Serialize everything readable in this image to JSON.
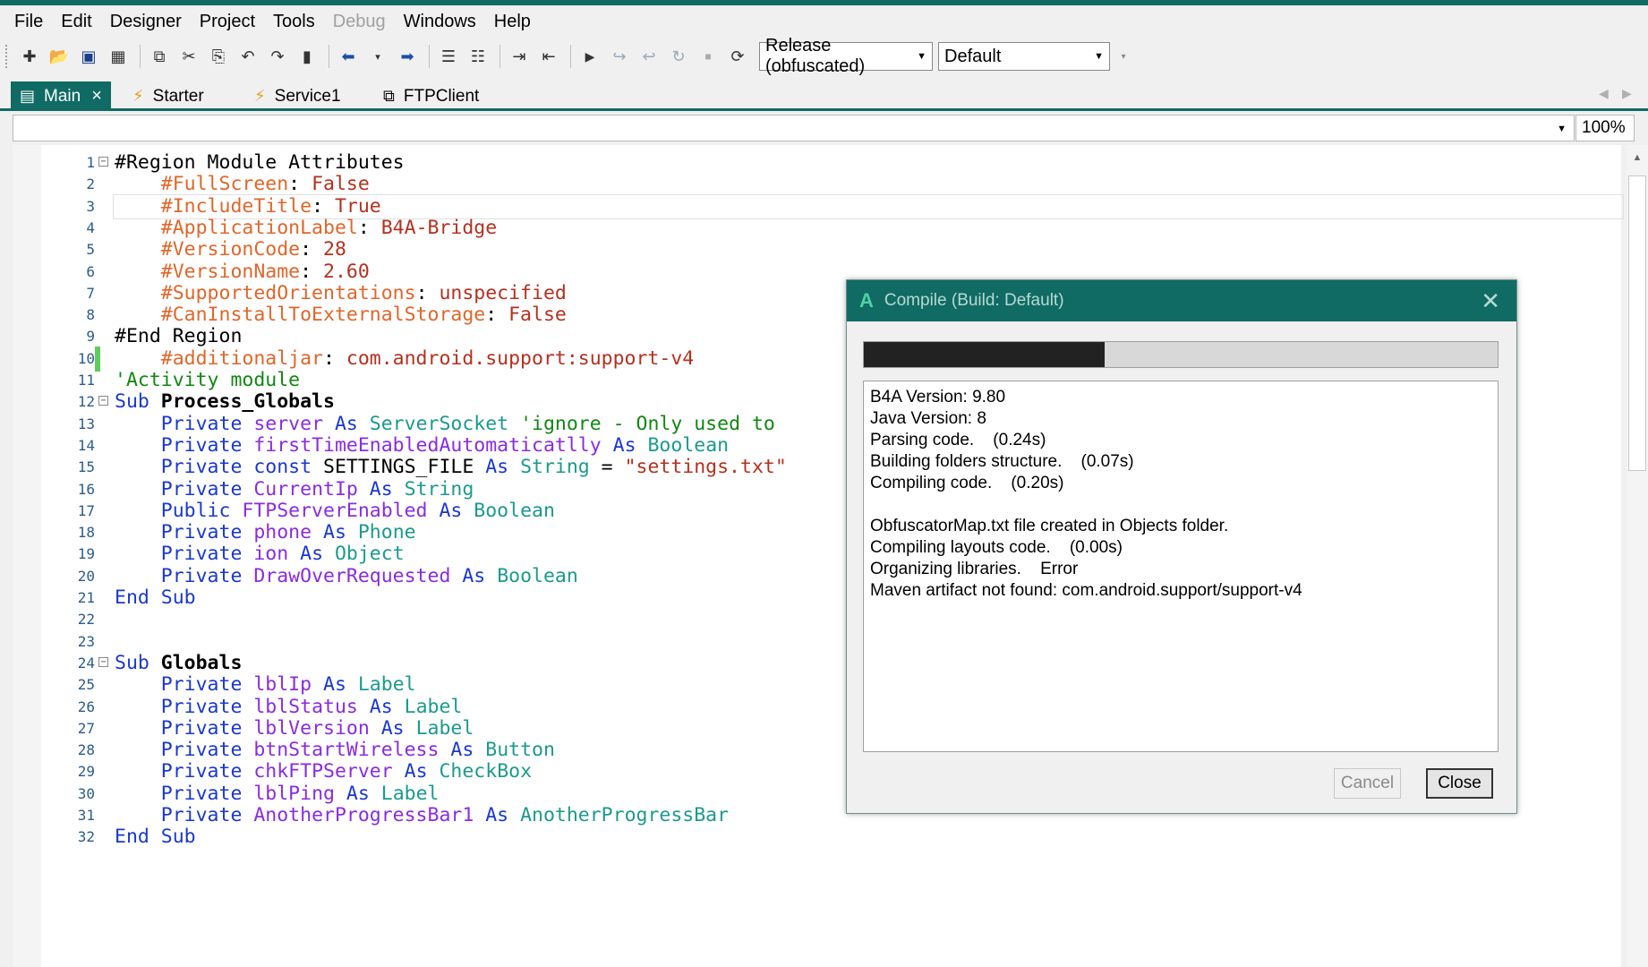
{
  "colors": {
    "accent": "#0f6b63",
    "keyword": "#1a38d0",
    "directive": "#e0662a",
    "type": "#1b9a8e",
    "variable": "#8a2be2",
    "string": "#b5301f",
    "comment": "#118711"
  },
  "menu": [
    "File",
    "Edit",
    "Designer",
    "Project",
    "Tools",
    "Debug",
    "Windows",
    "Help"
  ],
  "toolbar": {
    "build_config": "Release (obfuscated)",
    "build_target": "Default",
    "icons": [
      "new-module-icon",
      "open-icon",
      "save-icon",
      "save-all-icon",
      "copy-icon",
      "cut-icon",
      "paste-icon",
      "undo-icon",
      "redo-icon",
      "bookmark-icon",
      "back-icon",
      "forward-icon",
      "indent-icon",
      "outdent-icon",
      "comment-icon",
      "uncomment-icon",
      "run-icon",
      "step-icon",
      "step-into-icon",
      "step-over-icon",
      "stop-icon",
      "restart-icon"
    ]
  },
  "tabs": [
    {
      "label": "Main",
      "icon": "module-icon",
      "active": true
    },
    {
      "label": "Starter",
      "icon": "service-icon"
    },
    {
      "label": "Service1",
      "icon": "service-icon"
    },
    {
      "label": "FTPClient",
      "icon": "class-icon"
    }
  ],
  "zoom": "100%",
  "code": [
    {
      "n": "1",
      "fold": "⊟",
      "segs": [
        [
          "k-plain",
          "#Region Module Attributes"
        ]
      ]
    },
    {
      "n": "2",
      "segs": [
        [
          "k-plain",
          "    "
        ],
        [
          "k-dir",
          "#FullScreen"
        ],
        [
          "k-plain",
          ": "
        ],
        [
          "k-val",
          "False"
        ]
      ]
    },
    {
      "n": "3",
      "cur": true,
      "segs": [
        [
          "k-plain",
          "    "
        ],
        [
          "k-dir",
          "#IncludeTitle"
        ],
        [
          "k-plain",
          ": "
        ],
        [
          "k-val",
          "True"
        ]
      ]
    },
    {
      "n": "4",
      "segs": [
        [
          "k-plain",
          "    "
        ],
        [
          "k-dir",
          "#ApplicationLabel"
        ],
        [
          "k-plain",
          ": "
        ],
        [
          "k-val",
          "B4A-Bridge"
        ]
      ]
    },
    {
      "n": "5",
      "segs": [
        [
          "k-plain",
          "    "
        ],
        [
          "k-dir",
          "#VersionCode"
        ],
        [
          "k-plain",
          ": "
        ],
        [
          "k-val",
          "28"
        ]
      ]
    },
    {
      "n": "6",
      "segs": [
        [
          "k-plain",
          "    "
        ],
        [
          "k-dir",
          "#VersionName"
        ],
        [
          "k-plain",
          ": "
        ],
        [
          "k-val",
          "2.60"
        ]
      ]
    },
    {
      "n": "7",
      "segs": [
        [
          "k-plain",
          "    "
        ],
        [
          "k-dir",
          "#SupportedOrientations"
        ],
        [
          "k-plain",
          ": "
        ],
        [
          "k-val",
          "unspecified"
        ]
      ]
    },
    {
      "n": "8",
      "segs": [
        [
          "k-plain",
          "    "
        ],
        [
          "k-dir",
          "#CanInstallToExternalStorage"
        ],
        [
          "k-plain",
          ": "
        ],
        [
          "k-val",
          "False"
        ]
      ]
    },
    {
      "n": "9",
      "segs": [
        [
          "k-plain",
          "#End Region"
        ]
      ]
    },
    {
      "n": "10",
      "changed": true,
      "segs": [
        [
          "k-plain",
          "    "
        ],
        [
          "k-dir",
          "#additionaljar"
        ],
        [
          "k-plain",
          ": "
        ],
        [
          "k-val",
          "com.android.support:support-v4"
        ]
      ]
    },
    {
      "n": "11",
      "segs": [
        [
          "k-cmt",
          "'Activity module"
        ]
      ]
    },
    {
      "n": "12",
      "fold": "⊟",
      "segs": [
        [
          "k-kw",
          "Sub "
        ],
        [
          "k-bold",
          "Process_Globals"
        ]
      ]
    },
    {
      "n": "13",
      "segs": [
        [
          "k-plain",
          "    "
        ],
        [
          "k-kw",
          "Private "
        ],
        [
          "k-var",
          "server "
        ],
        [
          "k-kw",
          "As "
        ],
        [
          "k-type",
          "ServerSocket "
        ],
        [
          "k-cmt",
          "'ignore - Only used to"
        ]
      ]
    },
    {
      "n": "14",
      "segs": [
        [
          "k-plain",
          "    "
        ],
        [
          "k-kw",
          "Private "
        ],
        [
          "k-var",
          "firstTimeEnabledAutomaticatlly "
        ],
        [
          "k-kw",
          "As "
        ],
        [
          "k-type",
          "Boolean"
        ]
      ]
    },
    {
      "n": "15",
      "segs": [
        [
          "k-plain",
          "    "
        ],
        [
          "k-kw",
          "Private const "
        ],
        [
          "k-plain",
          "SETTINGS_FILE "
        ],
        [
          "k-kw",
          "As "
        ],
        [
          "k-type",
          "String "
        ],
        [
          "k-plain",
          "= "
        ],
        [
          "k-str",
          "\"settings.txt\""
        ]
      ]
    },
    {
      "n": "16",
      "segs": [
        [
          "k-plain",
          "    "
        ],
        [
          "k-kw",
          "Private "
        ],
        [
          "k-var",
          "CurrentIp "
        ],
        [
          "k-kw",
          "As "
        ],
        [
          "k-type",
          "String"
        ]
      ]
    },
    {
      "n": "17",
      "segs": [
        [
          "k-plain",
          "    "
        ],
        [
          "k-kw",
          "Public "
        ],
        [
          "k-var",
          "FTPServerEnabled "
        ],
        [
          "k-kw",
          "As "
        ],
        [
          "k-type",
          "Boolean"
        ]
      ]
    },
    {
      "n": "18",
      "segs": [
        [
          "k-plain",
          "    "
        ],
        [
          "k-kw",
          "Private "
        ],
        [
          "k-var",
          "phone "
        ],
        [
          "k-kw",
          "As "
        ],
        [
          "k-type",
          "Phone"
        ]
      ]
    },
    {
      "n": "19",
      "segs": [
        [
          "k-plain",
          "    "
        ],
        [
          "k-kw",
          "Private "
        ],
        [
          "k-var",
          "ion "
        ],
        [
          "k-kw",
          "As "
        ],
        [
          "k-type",
          "Object"
        ]
      ]
    },
    {
      "n": "20",
      "segs": [
        [
          "k-plain",
          "    "
        ],
        [
          "k-kw",
          "Private "
        ],
        [
          "k-var",
          "DrawOverRequested "
        ],
        [
          "k-kw",
          "As "
        ],
        [
          "k-type",
          "Boolean"
        ]
      ]
    },
    {
      "n": "21",
      "segs": [
        [
          "k-kw",
          "End Sub"
        ]
      ]
    },
    {
      "n": "22",
      "segs": []
    },
    {
      "n": "23",
      "segs": []
    },
    {
      "n": "24",
      "fold": "⊟",
      "segs": [
        [
          "k-kw",
          "Sub "
        ],
        [
          "k-bold",
          "Globals"
        ]
      ]
    },
    {
      "n": "25",
      "segs": [
        [
          "k-plain",
          "    "
        ],
        [
          "k-kw",
          "Private "
        ],
        [
          "k-var",
          "lblIp "
        ],
        [
          "k-kw",
          "As "
        ],
        [
          "k-type",
          "Label"
        ]
      ]
    },
    {
      "n": "26",
      "segs": [
        [
          "k-plain",
          "    "
        ],
        [
          "k-kw",
          "Private "
        ],
        [
          "k-var",
          "lblStatus "
        ],
        [
          "k-kw",
          "As "
        ],
        [
          "k-type",
          "Label"
        ]
      ]
    },
    {
      "n": "27",
      "segs": [
        [
          "k-plain",
          "    "
        ],
        [
          "k-kw",
          "Private "
        ],
        [
          "k-var",
          "lblVersion "
        ],
        [
          "k-kw",
          "As "
        ],
        [
          "k-type",
          "Label"
        ]
      ]
    },
    {
      "n": "28",
      "segs": [
        [
          "k-plain",
          "    "
        ],
        [
          "k-kw",
          "Private "
        ],
        [
          "k-var",
          "btnStartWireless "
        ],
        [
          "k-kw",
          "As "
        ],
        [
          "k-type",
          "Button"
        ]
      ]
    },
    {
      "n": "29",
      "segs": [
        [
          "k-plain",
          "    "
        ],
        [
          "k-kw",
          "Private "
        ],
        [
          "k-var",
          "chkFTPServer "
        ],
        [
          "k-kw",
          "As "
        ],
        [
          "k-type",
          "CheckBox"
        ]
      ]
    },
    {
      "n": "30",
      "segs": [
        [
          "k-plain",
          "    "
        ],
        [
          "k-kw",
          "Private "
        ],
        [
          "k-var",
          "lblPing "
        ],
        [
          "k-kw",
          "As "
        ],
        [
          "k-type",
          "Label"
        ]
      ]
    },
    {
      "n": "31",
      "segs": [
        [
          "k-plain",
          "    "
        ],
        [
          "k-kw",
          "Private "
        ],
        [
          "k-var",
          "AnotherProgressBar1 "
        ],
        [
          "k-kw",
          "As "
        ],
        [
          "k-type",
          "AnotherProgressBar"
        ]
      ]
    },
    {
      "n": "32",
      "segs": [
        [
          "k-kw",
          "End Sub"
        ]
      ]
    }
  ],
  "dialog": {
    "logo": "A",
    "title": "Compile (Build: Default)",
    "progress": 0.38,
    "log": [
      "B4A Version: 9.80",
      "Java Version: 8",
      "Parsing code.    (0.24s)",
      "Building folders structure.    (0.07s)",
      "Compiling code.    (0.20s)",
      "",
      "ObfuscatorMap.txt file created in Objects folder.",
      "Compiling layouts code.    (0.00s)",
      "Organizing libraries.    Error",
      "Maven artifact not found: com.android.support/support-v4"
    ],
    "cancel_label": "Cancel",
    "close_label": "Close"
  }
}
